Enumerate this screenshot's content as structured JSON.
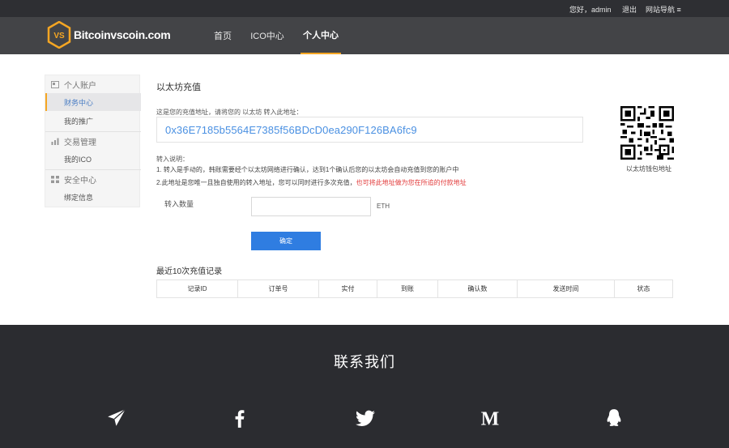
{
  "topbar": {
    "greeting": "您好，admin",
    "logout": "退出",
    "site_nav": "网站导航"
  },
  "header": {
    "logo_text": "Bitcoinvscoin.com",
    "logo_badge": "VS",
    "nav": [
      {
        "label": "首页"
      },
      {
        "label": "ICO中心"
      },
      {
        "label": "个人中心",
        "active": true
      }
    ]
  },
  "sidebar": {
    "groups": [
      {
        "label": "个人账户",
        "icon": "user-icon",
        "items": [
          "财务中心",
          "我的推广"
        ],
        "active_item": "财务中心"
      },
      {
        "label": "交易管理",
        "icon": "chart-icon",
        "items": [
          "我的ICO"
        ]
      },
      {
        "label": "安全中心",
        "icon": "grid-icon",
        "items": [
          "绑定信息"
        ]
      }
    ]
  },
  "main": {
    "title": "以太坊充值",
    "address_label": "这是您的充值地址，请将您的 以太坊 转入此地址：",
    "address": "0x36E7185b5564E7385f56BDcD0ea290F126BA6fc9",
    "qr_caption": "以太坊钱包地址",
    "note_heading": "转入说明：",
    "note1": "1. 转入是手动的，韩账需要经个以太坊网络进行确认，达到1个确认后您的以太坊会自动充值到您的账户中",
    "note2_prefix": "2.此地址是您唯一且独自使用的转入地址，您可以同时进行多次充值，",
    "note2_red": "也可将此地址做为您在所追的付款地址",
    "qty_label": "转入数量",
    "qty_value": "",
    "qty_unit": "ETH",
    "confirm_label": "确定",
    "records_title": "最近10次充值记录",
    "columns": [
      "记录ID",
      "订单号",
      "实付",
      "到账",
      "确认数",
      "发送时间",
      "状态"
    ]
  },
  "footer": {
    "contact_title": "联系我们",
    "social": [
      "telegram-icon",
      "facebook-icon",
      "twitter-icon",
      "medium-icon",
      "qq-icon"
    ]
  },
  "colors": {
    "accent": "#f5a623",
    "link_blue": "#4a90e2",
    "button_blue": "#2f7de1",
    "warning_red": "#e23a3a",
    "header_bg": "#434447",
    "footer_bg": "#2b2c30"
  }
}
